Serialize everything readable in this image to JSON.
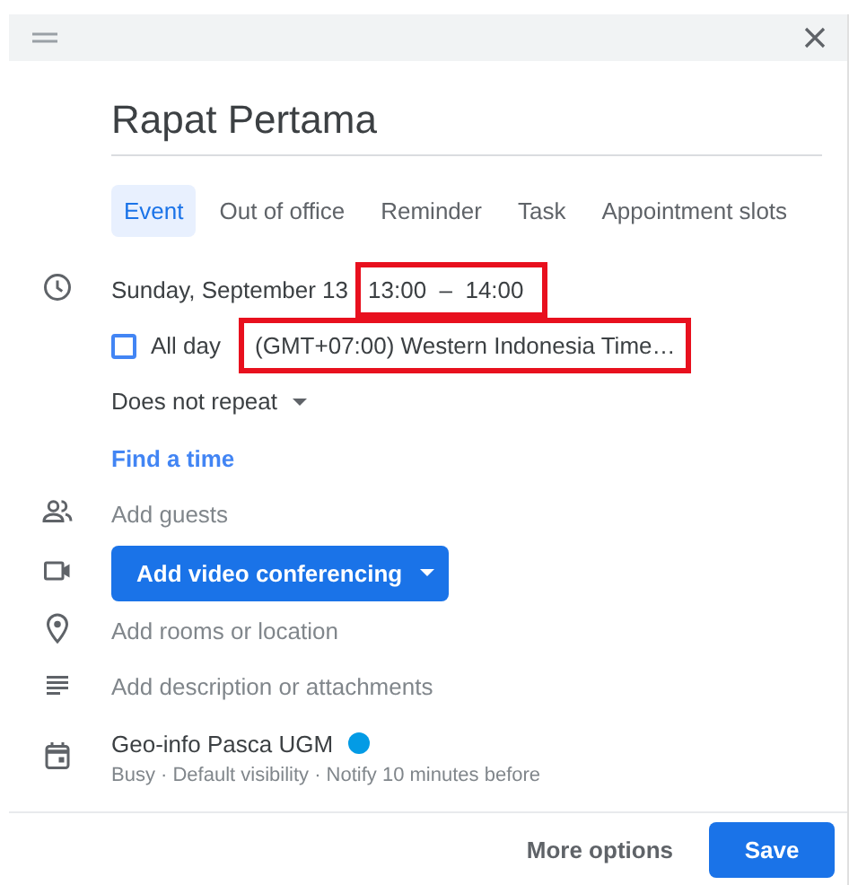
{
  "title": "Rapat Pertama",
  "tabs": [
    {
      "label": "Event",
      "selected": true
    },
    {
      "label": "Out of office",
      "selected": false
    },
    {
      "label": "Reminder",
      "selected": false
    },
    {
      "label": "Task",
      "selected": false
    },
    {
      "label": "Appointment slots",
      "selected": false
    }
  ],
  "date": "Sunday, September 13",
  "time": {
    "start": "13:00",
    "separator": "–",
    "end": "14:00",
    "highlighted": true
  },
  "all_day": {
    "label": "All day",
    "checked": false
  },
  "timezone": {
    "text": "(GMT+07:00) Western Indonesia Time…",
    "highlighted": true
  },
  "repeat": "Does not repeat",
  "find_time": "Find a time",
  "guests": {
    "placeholder": "Add guests"
  },
  "video_button": "Add video conferencing",
  "location": {
    "placeholder": "Add rooms or location"
  },
  "description": {
    "placeholder": "Add description or attachments"
  },
  "calendar": {
    "name": "Geo-info Pasca UGM",
    "color": "#039be5",
    "details": "Busy · Default visibility · Notify 10 minutes before"
  },
  "footer": {
    "more_options": "More options",
    "save": "Save"
  }
}
